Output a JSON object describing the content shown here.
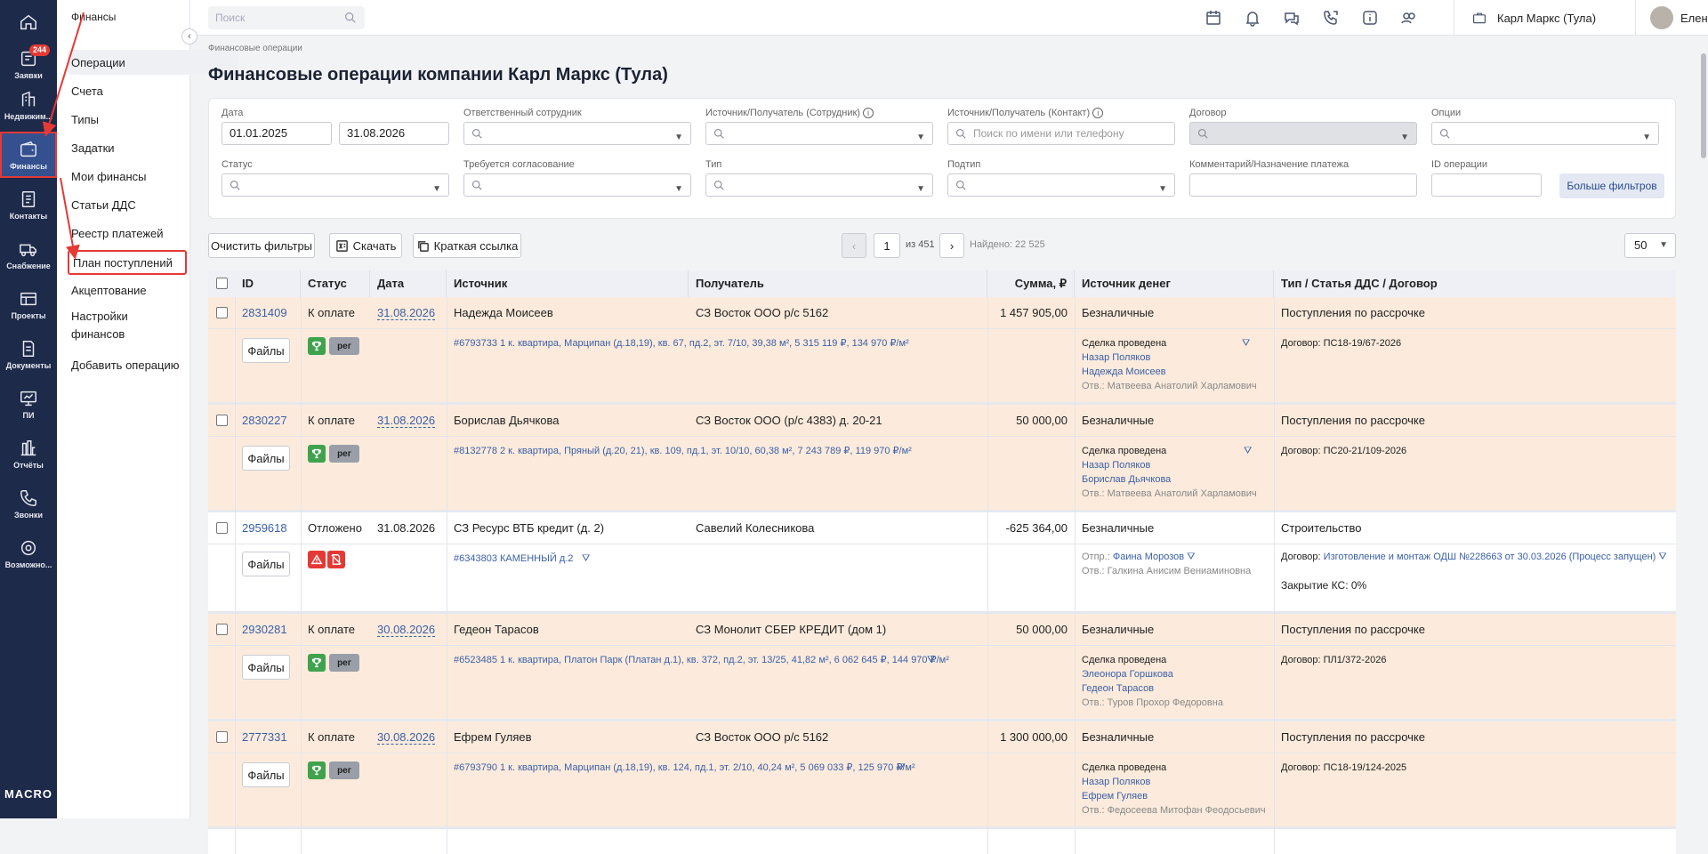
{
  "rail": {
    "items": [
      {
        "label": "",
        "icon": "home-icon"
      },
      {
        "label": "Заявки",
        "icon": "requests-icon",
        "badge": "244"
      },
      {
        "label": "Недвижим...",
        "icon": "realty-icon"
      },
      {
        "label": "Финансы",
        "icon": "wallet-icon"
      },
      {
        "label": "Контакты",
        "icon": "contacts-icon"
      },
      {
        "label": "Снабжение",
        "icon": "truck-icon"
      },
      {
        "label": "Проекты",
        "icon": "projects-icon"
      },
      {
        "label": "Документы",
        "icon": "documents-icon"
      },
      {
        "label": "ПИ",
        "icon": "monitor-icon"
      },
      {
        "label": "Отчёты",
        "icon": "reports-icon"
      },
      {
        "label": "Звонки",
        "icon": "phone-icon"
      },
      {
        "label": "Возможно...",
        "icon": "settings-icon"
      }
    ],
    "logo": "MACRO"
  },
  "submenu": {
    "title": "Финансы",
    "items": [
      "Операции",
      "Счета",
      "Типы",
      "Задатки",
      "Мои финансы",
      "Статьи ДДС",
      "Реестр платежей",
      "План поступлений",
      "Акцептование",
      "Настройки финансов",
      "Добавить операцию"
    ]
  },
  "topbar": {
    "search_placeholder": "Поиск",
    "company": "Карл Маркс (Тула)",
    "user": "Елена А."
  },
  "page": {
    "breadcrumb": "Финансовые операции",
    "title": "Финансовые операции компании Карл Маркс (Тула)"
  },
  "filters": {
    "date_label": "Дата",
    "date_from": "01.01.2025",
    "date_to": "31.08.2026",
    "responsible_label": "Ответственный сотрудник",
    "source_employee_label": "Источник/Получатель (Сотрудник)",
    "source_contact_label": "Источник/Получатель (Контакт)",
    "source_contact_placeholder": "Поиск по имени или телефону",
    "contract_label": "Договор",
    "options_label": "Опции",
    "status_label": "Статус",
    "approval_label": "Требуется согласование",
    "type_label": "Тип",
    "subtype_label": "Подтип",
    "comment_label": "Комментарий/Назначение платежа",
    "op_id_label": "ID операции",
    "more_filters": "Больше фильтров"
  },
  "toolbar": {
    "clear": "Очистить фильтры",
    "download": "Скачать",
    "short_link": "Краткая ссылка",
    "page": "1",
    "of_pages": "из 451",
    "found": "Найдено: 22 525",
    "per_page": "50"
  },
  "table": {
    "headers": [
      "ID",
      "Статус",
      "Дата",
      "Источник",
      "Получатель",
      "Сумма, ₽",
      "Источник денег",
      "Тип / Статья ДДС / Договор"
    ],
    "files_label": "Файлы",
    "reg_label": "рег",
    "rows": [
      {
        "id": "2831409",
        "status": "К оплате",
        "date": "31.08.2026",
        "source": "Надежда Моисеев",
        "receiver": "СЗ Восток ООО р/с 5162",
        "amount": "1 457 905,00",
        "money_source": "Безналичные",
        "type": "Поступления по рассрочке",
        "detail": "#6793733 1 к. квартира, Марципан (д.18,19), кв. 67, пд.2, эт. 7/10, 39,38 м², 5 315 119 ₽, 134 970 ₽/м²",
        "deal": "Сделка проведена",
        "p1": "Назар Поляков",
        "p2": "Надежда Моисеев",
        "resp": "Отв.: Матвеева Анатолий Харламович",
        "contract": "Договор: ПС18-19/67-2026"
      },
      {
        "id": "2830227",
        "status": "К оплате",
        "date": "31.08.2026",
        "source": "Борислав Дьячкова",
        "receiver": "СЗ Восток ООО (р/с 4383) д. 20-21",
        "amount": "50 000,00",
        "money_source": "Безналичные",
        "type": "Поступления по рассрочке",
        "detail": "#8132778 2 к. квартира, Пряный (д.20, 21), кв. 109, пд.1, эт. 10/10, 60,38 м², 7 243 789 ₽, 119 970 ₽/м²",
        "deal": "Сделка проведена",
        "p1": "Назар Поляков",
        "p2": "Борислав Дьячкова",
        "resp": "Отв.: Матвеева Анатолий Харламович",
        "contract": "Договор: ПС20-21/109-2026"
      },
      {
        "id": "2959618",
        "status": "Отложено",
        "date": "31.08.2026",
        "source": "СЗ Ресурс ВТБ кредит (д. 2)",
        "receiver": "Савелий Колесникова",
        "amount": "-625 364,00",
        "money_source": "Безналичные",
        "type": "Строительство",
        "detail": "#6343803 КАМЕННЫЙ д.2",
        "sender_label": "Отпр.:",
        "sender": "Фаина Морозов",
        "resp": "Отв.: Галкина Анисим Вениаминовна",
        "contract_label": "Договор:",
        "contract_link": "Изготовление и монтаж ОДШ №228663 от 30.03.2026 (Процесс запущен)",
        "closing": "Закрытие КС: 0%"
      },
      {
        "id": "2930281",
        "status": "К оплате",
        "date": "30.08.2026",
        "source": "Гедеон Тарасов",
        "receiver": "СЗ Монолит СБЕР КРЕДИТ (дом 1)",
        "amount": "50 000,00",
        "money_source": "Безналичные",
        "type": "Поступления по рассрочке",
        "detail": "#6523485 1 к. квартира, Платон Парк (Платан д.1), кв. 372, пд.2, эт. 13/25, 41,82 м², 6 062 645 ₽, 144 970 ₽/м²",
        "deal": "Сделка проведена",
        "p1": "Элеонора Горшкова",
        "p2": "Гедеон Тарасов",
        "resp": "Отв.: Туров Прохор Федоровна",
        "contract": "Договор: ПЛ1/372-2026"
      },
      {
        "id": "2777331",
        "status": "К оплате",
        "date": "30.08.2026",
        "source": "Ефрем Гуляев",
        "receiver": "СЗ Восток ООО р/с 5162",
        "amount": "1 300 000,00",
        "money_source": "Безналичные",
        "type": "Поступления по рассрочке",
        "detail": "#6793790 1 к. квартира, Марципан (д.18,19), кв. 124, пд.1, эт. 2/10, 40,24 м², 5 069 033 ₽, 125 970 ₽/м²",
        "deal": "Сделка проведена",
        "p1": "Назар Поляков",
        "p2": "Ефрем Гуляев",
        "resp": "Отв.: Федосеева Митофан Феодосьевич",
        "contract": "Договор: ПС18-19/124-2025"
      }
    ]
  },
  "colors": {
    "rail": "#1e2a4a",
    "accent": "#3a5fa8",
    "peach_row": "#fcebdc",
    "highlight": "#e53935"
  }
}
